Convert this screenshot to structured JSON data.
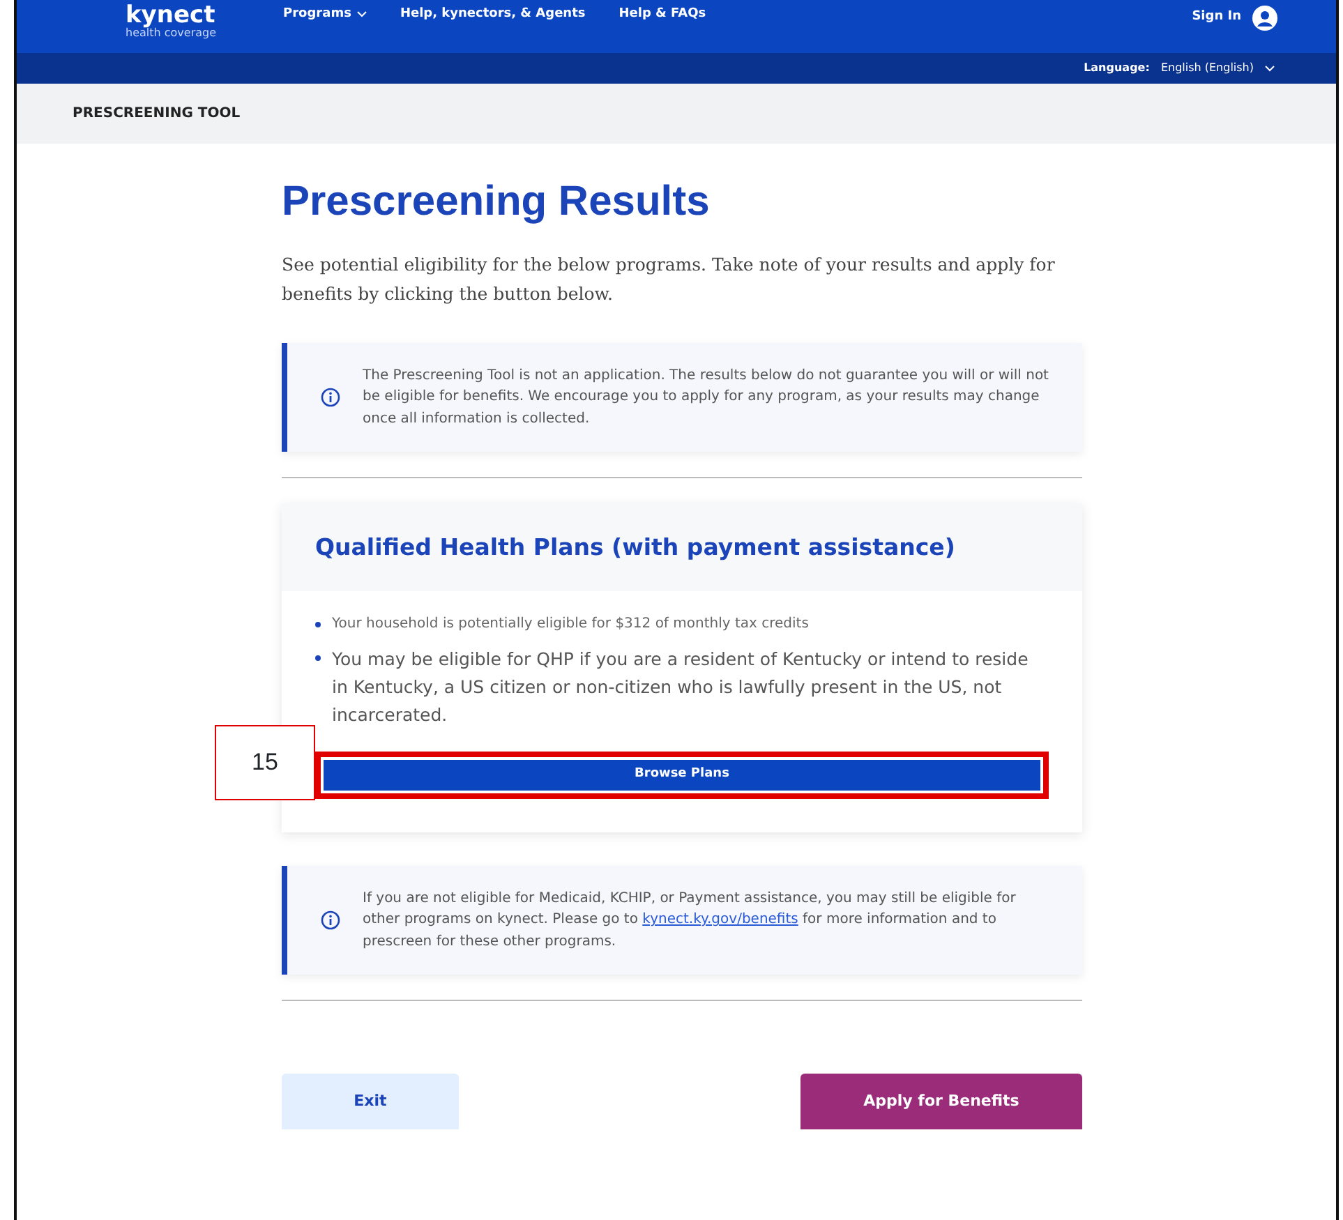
{
  "header": {
    "logo": "kynect",
    "tagline": "health coverage",
    "nav": [
      {
        "label": "Programs",
        "dropdown": true
      },
      {
        "label": "Help, kynectors, & Agents",
        "dropdown": false
      },
      {
        "label": "Help & FAQs",
        "dropdown": false
      }
    ],
    "sign_in": "Sign In",
    "language_label": "Language:",
    "language_value": "English (English)"
  },
  "breadcrumb": "PRESCREENING TOOL",
  "title": "Prescreening Results",
  "intro": "See potential eligibility for the below programs. Take note of your results and apply for benefits by clicking the button below.",
  "notice_top": "The Prescreening Tool is not an application. The results below do not guarantee you will or will not be eligible for benefits. We encourage you to apply for any program, as your results may change once all information is collected.",
  "program_card": {
    "title": "Qualified Health Plans (with payment assistance)",
    "bullets": [
      {
        "text": "Your household is potentially eligible for $312 of monthly tax credits",
        "kind": "small"
      },
      {
        "text": "You may be eligible for QHP if you are a resident of Kentucky or intend to reside in Kentucky, a US citizen or non-citizen who is lawfully present in the US, not incarcerated.",
        "kind": "large"
      }
    ],
    "button": {
      "label": "Browse Plans",
      "highlighted": true,
      "annotation": "15"
    }
  },
  "notice_bottom": {
    "before": "If you are not eligible for Medicaid, KCHIP, or Payment assistance, you may still be eligible for other programs on kynect. Please go to ",
    "link": "kynect.ky.gov/benefits",
    "after": " for more information and to prescreen for these other programs."
  },
  "actions": [
    {
      "label": "Exit",
      "kind": "secondary"
    },
    {
      "label": "Apply for Benefits",
      "kind": "primary"
    }
  ]
}
